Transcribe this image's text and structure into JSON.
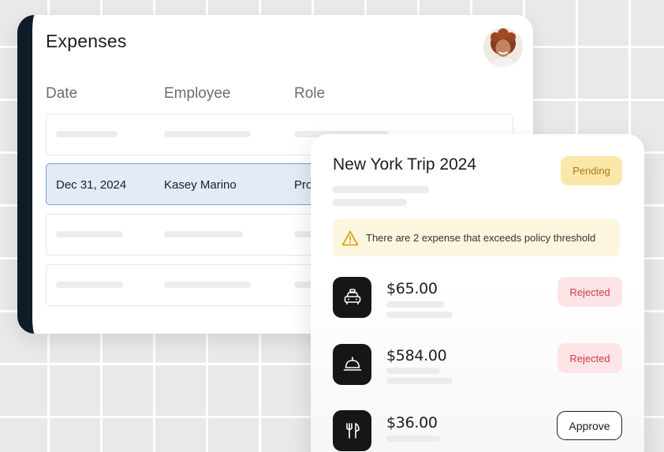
{
  "expenses": {
    "title": "Expenses",
    "columns": [
      "Date",
      "Employee",
      "Role"
    ],
    "selected_row": {
      "date": "Dec 31, 2024",
      "employee": "Kasey Marino",
      "role": "Pro"
    }
  },
  "trip": {
    "title": "New York Trip 2024",
    "status": "Pending",
    "warning": "There are 2 expense that exceeds policy threshold",
    "items": [
      {
        "icon": "taxi-icon",
        "amount": "$65.00",
        "status": "Rejected"
      },
      {
        "icon": "service-bell-icon",
        "amount": "$584.00",
        "status": "Rejected"
      },
      {
        "icon": "fork-knife-icon",
        "amount": "$36.00",
        "action": "Approve"
      }
    ]
  },
  "colors": {
    "sidebar": "#0e1c2a",
    "selected_row_bg": "#e4ebf8",
    "selected_row_border": "#7e9ad6",
    "pending_bg": "#fbe7a9",
    "pending_text": "#a7780c",
    "rejected_bg": "#fde4e6",
    "rejected_text": "#cc3e4a",
    "warning_bg": "#fdf6de",
    "icon_tile": "#161616"
  }
}
